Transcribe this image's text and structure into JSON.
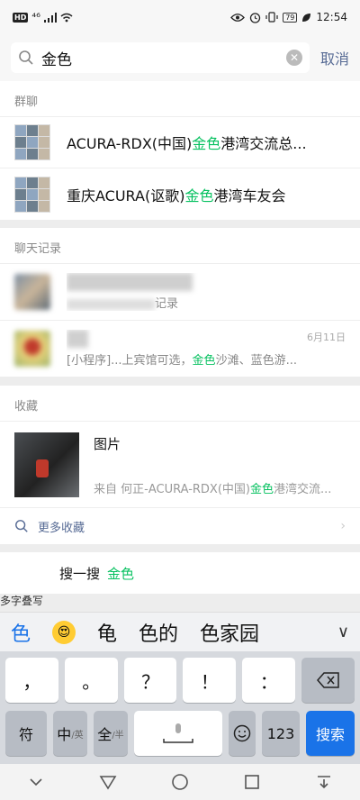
{
  "status": {
    "network": "HD",
    "signal": "⁴⁶",
    "battery": "79",
    "time": "12:54"
  },
  "search": {
    "query": "金色",
    "cancel_label": "取消"
  },
  "groups": {
    "title": "群聊",
    "items": [
      {
        "pre": "ACURA-RDX(中国)",
        "hit": "金色",
        "post": "港湾交流总..."
      },
      {
        "pre": "重庆ACURA(讴歌)",
        "hit": "金色",
        "post": "港湾车友会"
      }
    ]
  },
  "chats": {
    "title": "聊天记录",
    "items": [
      {
        "name": "",
        "snippet": "记录",
        "date": ""
      },
      {
        "name": "",
        "pre": "[小程序]...上宾馆可选，",
        "hit": "金色",
        "post": "沙滩、蓝色游...",
        "date": "6月11日"
      }
    ]
  },
  "favorites": {
    "title": "收藏",
    "item_title": "图片",
    "source_pre": "来自 何正-ACURA-RDX(中国)",
    "source_hit": "金色",
    "source_post": "港湾交流...",
    "more_label": "更多收藏"
  },
  "sousou": {
    "multi_label": "多字叠写",
    "label": "搜一搜",
    "term": "金色"
  },
  "keyboard": {
    "candidates": [
      "色",
      "龟",
      "色的",
      "色家园"
    ],
    "row1": [
      "，",
      "。",
      "？",
      "！",
      "："
    ],
    "fu": "符",
    "zh": "中",
    "zh_sub": "/英",
    "quan": "全",
    "quan_sub": "/半",
    "num": "123",
    "go": "搜索"
  }
}
